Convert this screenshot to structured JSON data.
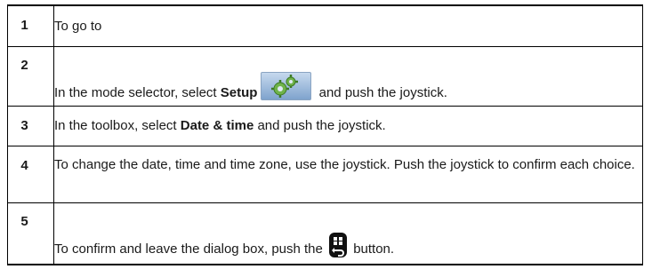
{
  "steps": [
    {
      "number": "1",
      "text": "To go to"
    },
    {
      "number": "2",
      "pre": "In the mode selector, select ",
      "bold": "Setup",
      "post": " and push the joystick.",
      "icon": "setup-gears-icon"
    },
    {
      "number": "3",
      "pre": "In the toolbox, select ",
      "bold": "Date & time",
      "post": " and push the joystick."
    },
    {
      "number": "4",
      "text": "To change the date, time and time zone, use the joystick. Push the joystick to confirm each choice."
    },
    {
      "number": "5",
      "pre": "To confirm and leave the dialog box, push the ",
      "post": " button.",
      "icon": "menu-back-button-icon"
    }
  ]
}
